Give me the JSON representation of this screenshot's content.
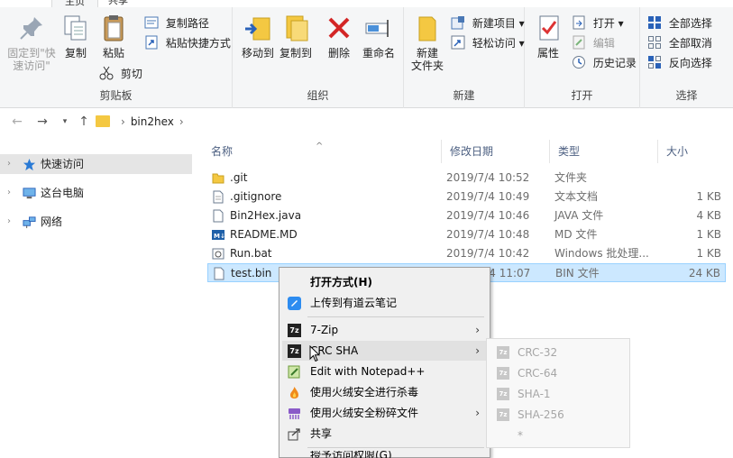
{
  "tabs": [
    {
      "label": "主页"
    },
    {
      "label": "共享"
    }
  ],
  "ribbon": {
    "clipboard": {
      "label": "剪贴板",
      "pin_line1": "固定到\"快",
      "pin_line2": "速访问\"",
      "copy": "复制",
      "paste": "粘贴",
      "copy_path": "复制路径",
      "paste_shortcut": "粘贴快捷方式",
      "cut": "剪切"
    },
    "organize": {
      "label": "组织",
      "move_to": "移动到",
      "copy_to": "复制到",
      "delete": "删除",
      "rename": "重命名"
    },
    "new": {
      "label": "新建",
      "new_folder_line1": "新建",
      "new_folder_line2": "文件夹",
      "new_item": "新建项目",
      "easy_access": "轻松访问"
    },
    "open": {
      "label": "打开",
      "properties": "属性",
      "open": "打开",
      "edit": "编辑",
      "history": "历史记录"
    },
    "select": {
      "label": "选择",
      "select_all": "全部选择",
      "select_none": "全部取消",
      "invert": "反向选择"
    }
  },
  "address": {
    "path": "bin2hex"
  },
  "nav": {
    "items": [
      {
        "label": "快速访问"
      },
      {
        "label": "这台电脑"
      },
      {
        "label": "网络"
      }
    ]
  },
  "columns": {
    "name": "名称",
    "date": "修改日期",
    "type": "类型",
    "size": "大小"
  },
  "files": [
    {
      "name": ".git",
      "date": "2019/7/4 10:52",
      "type": "文件夹",
      "size": ""
    },
    {
      "name": ".gitignore",
      "date": "2019/7/4 10:49",
      "type": "文本文档",
      "size": "1 KB"
    },
    {
      "name": "Bin2Hex.java",
      "date": "2019/7/4 10:46",
      "type": "JAVA 文件",
      "size": "4 KB"
    },
    {
      "name": "README.MD",
      "date": "2019/7/4 10:48",
      "type": "MD 文件",
      "size": "1 KB"
    },
    {
      "name": "Run.bat",
      "date": "2019/7/4 10:42",
      "type": "Windows 批处理...",
      "size": "1 KB"
    },
    {
      "name": "test.bin",
      "date": "2019/7/4 11:07",
      "type": "BIN 文件",
      "size": "24 KB"
    }
  ],
  "context_menu": {
    "items": [
      {
        "label": "打开方式(H)"
      },
      {
        "label": "上传到有道云笔记"
      },
      {
        "label": "7-Zip"
      },
      {
        "label": "CRC SHA"
      },
      {
        "label": "Edit with Notepad++"
      },
      {
        "label": "使用火绒安全进行杀毒"
      },
      {
        "label": "使用火绒安全粉碎文件"
      },
      {
        "label": "共享"
      },
      {
        "label": "授予访问权限(G)"
      }
    ]
  },
  "submenu": {
    "items": [
      {
        "label": "CRC-32"
      },
      {
        "label": "CRC-64"
      },
      {
        "label": "SHA-1"
      },
      {
        "label": "SHA-256"
      },
      {
        "label": "*"
      }
    ]
  },
  "colors": {
    "selection_bg": "#cce8ff",
    "selection_border": "#99d1ff",
    "accent_blue": "#1e73be",
    "folder_yellow": "#f4c842",
    "delete_red": "#d32626"
  }
}
